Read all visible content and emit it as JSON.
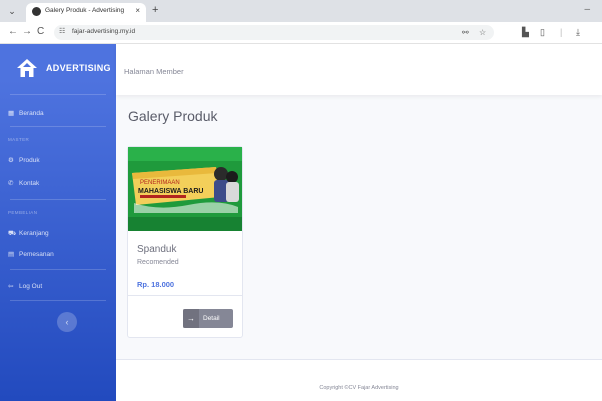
{
  "browser": {
    "tab_title": "Galery Produk - Advertising",
    "tab_close": "×",
    "new_tab": "+",
    "minimize": "–",
    "url": "fajar-advertising.my.id",
    "back": "←",
    "forward": "→",
    "reload": "C"
  },
  "sidebar": {
    "brand": "ADVERTISING",
    "items": [
      {
        "label": "Beranda"
      },
      {
        "label": "Produk"
      },
      {
        "label": "Kontak"
      },
      {
        "label": "Keranjang"
      },
      {
        "label": "Pemesanan"
      },
      {
        "label": "Log Out"
      }
    ],
    "headings": [
      "MASTER",
      "PEMBELIAN"
    ],
    "toggle": "‹"
  },
  "topbar": {
    "title": "Halaman Member"
  },
  "page": {
    "title": "Galery Produk"
  },
  "products": [
    {
      "banner_line1": "PENERIMAAN",
      "banner_line2": "MAHASISWA BARU",
      "name": "Spanduk",
      "subtitle": "Recomended",
      "price": "Rp. 18.000",
      "button": "Detail",
      "button_icon": "→"
    }
  ],
  "footer": {
    "text": "Copyright ©CV Fajar Advertising"
  },
  "colors": {
    "primary": "#4e73df",
    "sidebar_dark": "#224abe",
    "banner_green": "#1f9a3c"
  }
}
